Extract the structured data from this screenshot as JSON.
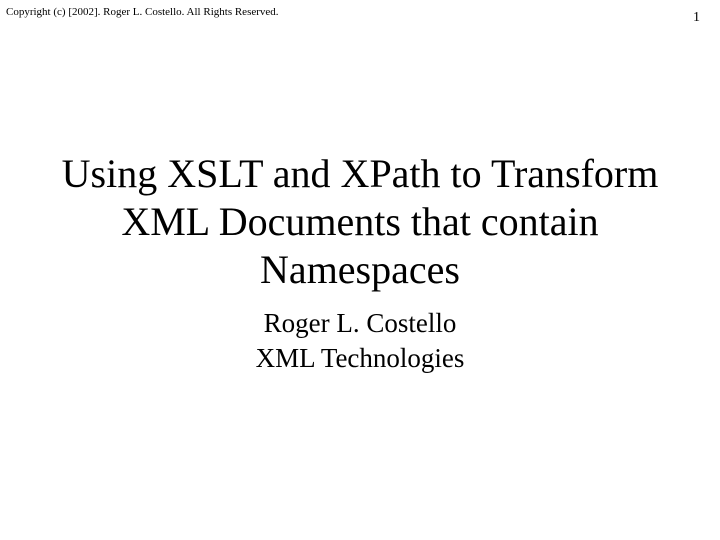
{
  "header": {
    "copyright": "Copyright (c) [2002].  Roger L. Costello.  All Rights Reserved.",
    "page_number": "1"
  },
  "slide": {
    "title": "Using XSLT and XPath to Transform XML Documents that contain Namespaces",
    "author": "Roger L. Costello",
    "organization": "XML Technologies"
  }
}
